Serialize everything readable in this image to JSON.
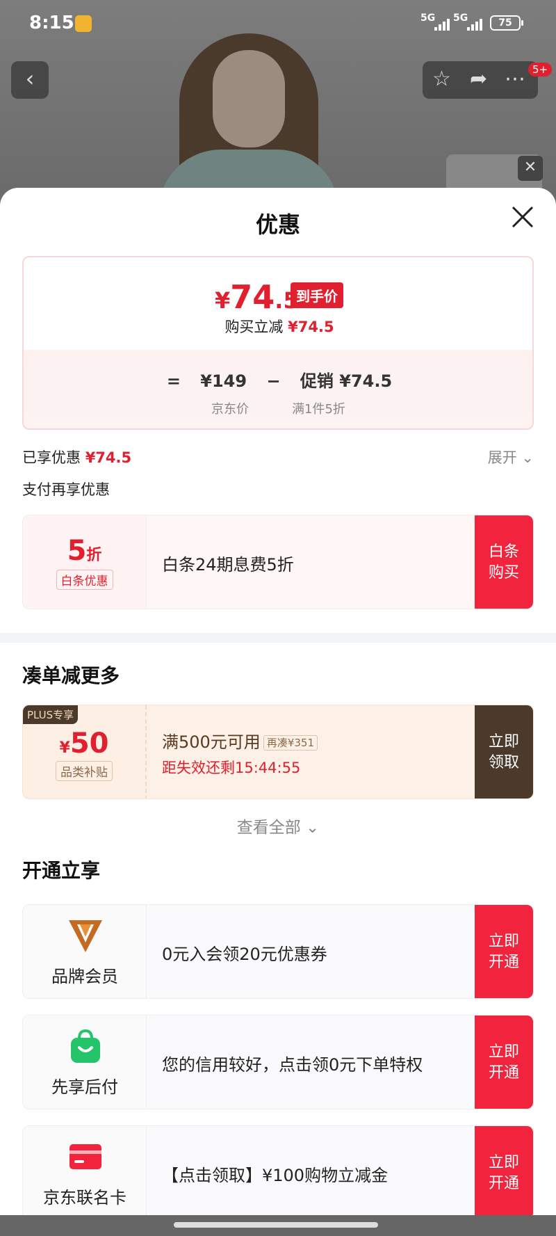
{
  "status_bar": {
    "time": "8:15",
    "signal1": "5G",
    "signal2": "5G",
    "battery": "75"
  },
  "nav": {
    "badge": "5+"
  },
  "sheet": {
    "title": "优惠",
    "price": {
      "symbol": "¥",
      "integer": "74",
      "decimal": ".5",
      "tag": "到手价",
      "instant_label": "购买立减",
      "instant_value": "¥74.5",
      "eq": "=",
      "base_price": "¥149",
      "minus": "−",
      "promo_label": "促销",
      "promo_value": "¥74.5",
      "base_caption": "京东价",
      "promo_caption": "满1件5折"
    },
    "enjoyed_label": "已享优惠",
    "enjoyed_value": "¥74.5",
    "expand": "展开",
    "pay_more": "支付再享优惠",
    "baitiao": {
      "value": "5",
      "unit": "折",
      "tag": "白条优惠",
      "text": "白条24期息费5折",
      "cta": "白条购买"
    },
    "bundle_title": "凑单减更多",
    "coupon": {
      "plus": "PLUS专享",
      "symbol": "¥",
      "value": "50",
      "tag": "品类补贴",
      "line1": "满500元可用",
      "pill": "再凑¥351",
      "line2": "距失效还剩15:44:55",
      "cta": "立即领取"
    },
    "see_all": "查看全部",
    "open_title": "开通立享",
    "services": [
      {
        "icon": "brand-member-icon",
        "label": "品牌会员",
        "text": "0元入会领20元优惠券",
        "cta": "立即开通"
      },
      {
        "icon": "shopping-bag-icon",
        "label": "先享后付",
        "text": "您的信用较好，点击领0元下单特权",
        "cta": "立即开通"
      },
      {
        "icon": "credit-card-icon",
        "label": "京东联名卡",
        "text": "【点击领取】¥100购物立减金",
        "cta": "立即开通"
      }
    ]
  },
  "colors": {
    "accent": "#e0202e",
    "cta": "#f2233c",
    "plus_brown": "#4b3a2b"
  }
}
